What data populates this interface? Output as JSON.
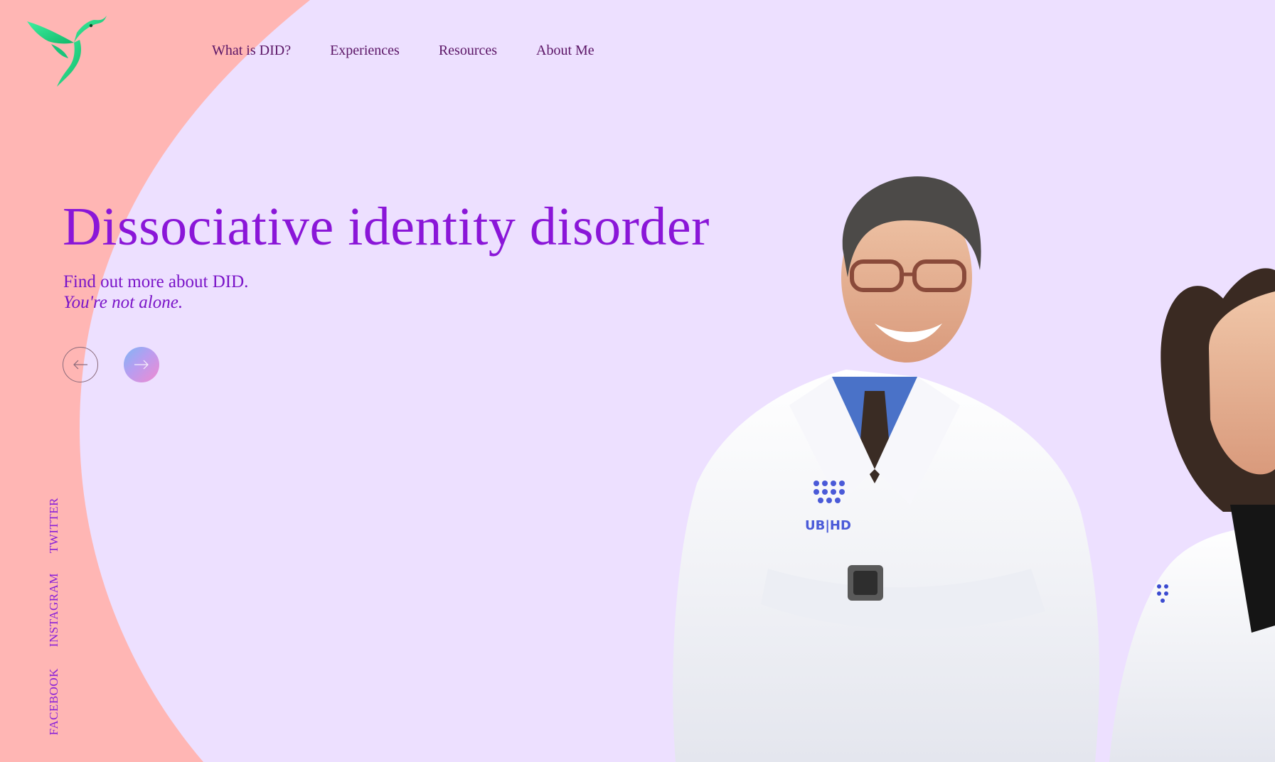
{
  "nav": {
    "items": [
      {
        "label": "What is DID?"
      },
      {
        "label": "Experiences"
      },
      {
        "label": "Resources"
      },
      {
        "label": "About Me"
      }
    ]
  },
  "hero": {
    "title": "Dissociative identity disorder",
    "subtitle": "Find out more about DID.",
    "tagline": "You're not alone."
  },
  "carousel": {
    "prev_icon": "arrow-left-icon",
    "next_icon": "arrow-right-icon"
  },
  "social": {
    "twitter": "TWITTER",
    "instagram": "INSTAGRAM",
    "facebook": "FACEBOOK"
  },
  "photo": {
    "badge_text": "UB|HD"
  },
  "colors": {
    "background": "#ede0ff",
    "accent_curve": "#ffb6b4",
    "title": "#8a16d8",
    "nav_text": "#5b1566",
    "logo_green": "#1fd98a"
  }
}
